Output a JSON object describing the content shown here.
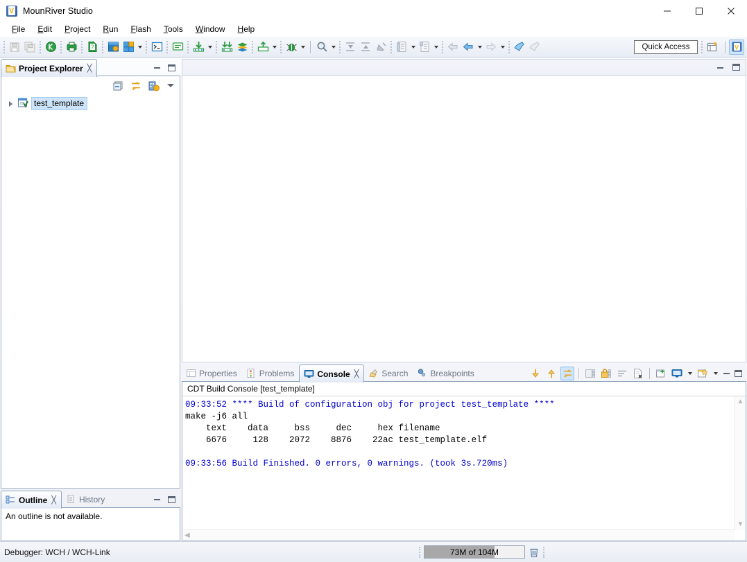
{
  "window": {
    "title": "MounRiver Studio",
    "app_icon": "mounriver-logo-icon",
    "minimize": "minimize-button",
    "maximize": "maximize-button",
    "close": "close-button"
  },
  "menubar": {
    "items": [
      {
        "label": "File",
        "mnemonic": "F"
      },
      {
        "label": "Edit",
        "mnemonic": "E"
      },
      {
        "label": "Project",
        "mnemonic": "P"
      },
      {
        "label": "Run",
        "mnemonic": "R"
      },
      {
        "label": "Flash",
        "mnemonic": "F"
      },
      {
        "label": "Tools",
        "mnemonic": "T"
      },
      {
        "label": "Window",
        "mnemonic": "W"
      },
      {
        "label": "Help",
        "mnemonic": "H"
      }
    ]
  },
  "toolbar": {
    "groups": [
      {
        "buttons": [
          {
            "name": "save-icon",
            "disabled": true
          },
          {
            "name": "save-all-icon",
            "disabled": true
          }
        ]
      },
      {
        "buttons": [
          {
            "name": "build-project-icon",
            "disabled": false
          }
        ]
      },
      {
        "buttons": [
          {
            "name": "print-icon",
            "disabled": false
          }
        ]
      },
      {
        "buttons": [
          {
            "name": "new-file-icon",
            "disabled": false
          }
        ]
      },
      {
        "buttons": [
          {
            "name": "new-project-icon",
            "disabled": false
          },
          {
            "name": "new-wizard-icon",
            "disabled": false,
            "dropdown": true
          }
        ]
      },
      {
        "buttons": [
          {
            "name": "terminal-icon",
            "disabled": false
          }
        ]
      },
      {
        "buttons": [
          {
            "name": "console-view-icon",
            "disabled": false
          }
        ]
      },
      {
        "buttons": [
          {
            "name": "download-icon",
            "disabled": false,
            "dropdown": true
          }
        ]
      },
      {
        "buttons": [
          {
            "name": "download-all-icon",
            "disabled": false
          },
          {
            "name": "library-icon",
            "disabled": false
          }
        ]
      },
      {
        "buttons": [
          {
            "name": "import-icon",
            "disabled": false,
            "dropdown": true
          }
        ]
      },
      {
        "buttons": [
          {
            "name": "debug-bug-icon",
            "disabled": false,
            "dropdown": true
          }
        ]
      },
      {
        "buttons": [
          {
            "name": "search-icon",
            "disabled": false,
            "dropdown": true
          }
        ]
      },
      {
        "buttons": [
          {
            "name": "next-annotation-icon",
            "disabled": true
          },
          {
            "name": "previous-annotation-icon",
            "disabled": true
          },
          {
            "name": "last-edit-location-icon",
            "disabled": true
          }
        ]
      },
      {
        "buttons": [
          {
            "name": "open-type-icon",
            "disabled": true,
            "dropdown": true
          },
          {
            "name": "open-element-icon",
            "disabled": true,
            "dropdown": true
          }
        ]
      },
      {
        "buttons": [
          {
            "name": "back-history-icon",
            "disabled": true
          },
          {
            "name": "back-arrow-icon",
            "disabled": false,
            "dropdown": true
          },
          {
            "name": "forward-arrow-icon",
            "disabled": true,
            "dropdown": true
          }
        ]
      },
      {
        "buttons": [
          {
            "name": "pin-editor-icon",
            "disabled": false
          },
          {
            "name": "restore-icon",
            "disabled": true
          }
        ]
      }
    ],
    "quick_access": {
      "label": "Quick Access",
      "placeholder": "Quick Access"
    },
    "perspective_new_icon": "open-perspective-icon",
    "perspective_active_icon": "mounriver-perspective-icon"
  },
  "project_explorer": {
    "tab": {
      "label": "Project Explorer",
      "icon": "project-explorer-icon",
      "close": "╳"
    },
    "view_tools": [
      {
        "name": "collapse-all-icon"
      },
      {
        "name": "link-with-editor-icon"
      },
      {
        "name": "build-configurations-icon"
      },
      {
        "name": "view-menu-icon"
      }
    ],
    "minimize": "minimize-view-button",
    "maximize": "maximize-view-button",
    "tree": [
      {
        "label": "test_template",
        "icon": "c-project-icon",
        "expanded": false,
        "selected": true
      }
    ]
  },
  "outline_part": {
    "tabs": [
      {
        "label": "Outline",
        "icon": "outline-icon",
        "active": true,
        "close": "╳"
      },
      {
        "label": "History",
        "icon": "history-icon",
        "active": false
      }
    ],
    "message": "An outline is not available.",
    "minimize": "minimize-view-button",
    "maximize": "maximize-view-button"
  },
  "editor_area": {
    "minimize": "minimize-editor-button",
    "maximize": "maximize-editor-button",
    "empty": true
  },
  "console_part": {
    "tabs": [
      {
        "label": "Properties",
        "icon": "properties-icon",
        "active": false
      },
      {
        "label": "Problems",
        "icon": "problems-icon",
        "active": false
      },
      {
        "label": "Console",
        "icon": "console-icon",
        "active": true,
        "close": "╳"
      },
      {
        "label": "Search",
        "icon": "search-pencil-icon",
        "active": false
      },
      {
        "label": "Breakpoints",
        "icon": "breakpoints-icon",
        "active": false
      }
    ],
    "tools": [
      {
        "name": "scroll-down-icon",
        "state": "off"
      },
      {
        "name": "scroll-up-icon",
        "state": "off"
      },
      {
        "name": "scroll-lock-icon",
        "state": "on"
      },
      {
        "name": "save-console-icon",
        "state": "disabled"
      },
      {
        "name": "lock-console-icon",
        "state": "off"
      },
      {
        "name": "word-wrap-icon",
        "state": "disabled"
      },
      {
        "name": "clear-console-icon",
        "state": "off"
      },
      {
        "name": "pin-console-icon",
        "state": "off"
      },
      {
        "name": "display-console-icon",
        "state": "off",
        "dropdown": true
      },
      {
        "name": "open-console-icon",
        "state": "off",
        "dropdown": true
      }
    ],
    "minimize": "minimize-view-button",
    "maximize": "maximize-view-button",
    "header": "CDT Build Console [test_template]",
    "lines": [
      {
        "text": "09:33:52 **** Build of configuration obj for project test_template ****",
        "color": "blue"
      },
      {
        "text": "make -j6 all",
        "color": "black"
      },
      {
        "text": "   text\tdata\t bss\t dec\t hex filename",
        "color": "black"
      },
      {
        "text": "   6676\t 128\t2072\t8876\t22ac test_template.elf",
        "color": "black"
      },
      {
        "text": "",
        "color": "black"
      },
      {
        "text": "09:33:56 Build Finished. 0 errors, 0 warnings. (took 3s.720ms)",
        "color": "blue"
      }
    ],
    "console_text": "09:33:52 **** Build of configuration obj for project test_template ****\nmake -j6 all\n   text\t   data\t    bss\t    dec\t    hex filename\n   6676\t    128\t   2072\t   8876\t   22ac test_template.elf\n\n09:33:56 Build Finished. 0 errors, 0 warnings. (took 3s.720ms)"
  },
  "statusbar": {
    "debugger_label": "Debugger: WCH / WCH-Link",
    "memory": {
      "label": "73M of 104M",
      "used_mb": 73,
      "total_mb": 104,
      "percent": 70,
      "trash_icon": "trash-icon"
    }
  },
  "colors": {
    "console_blue": "#0000d0",
    "selection_blue": "#cde3f7",
    "accent_green": "#2f9e44",
    "toolbar_bg": "#e8edf5",
    "gauge_fill": "#a8a8a8"
  }
}
